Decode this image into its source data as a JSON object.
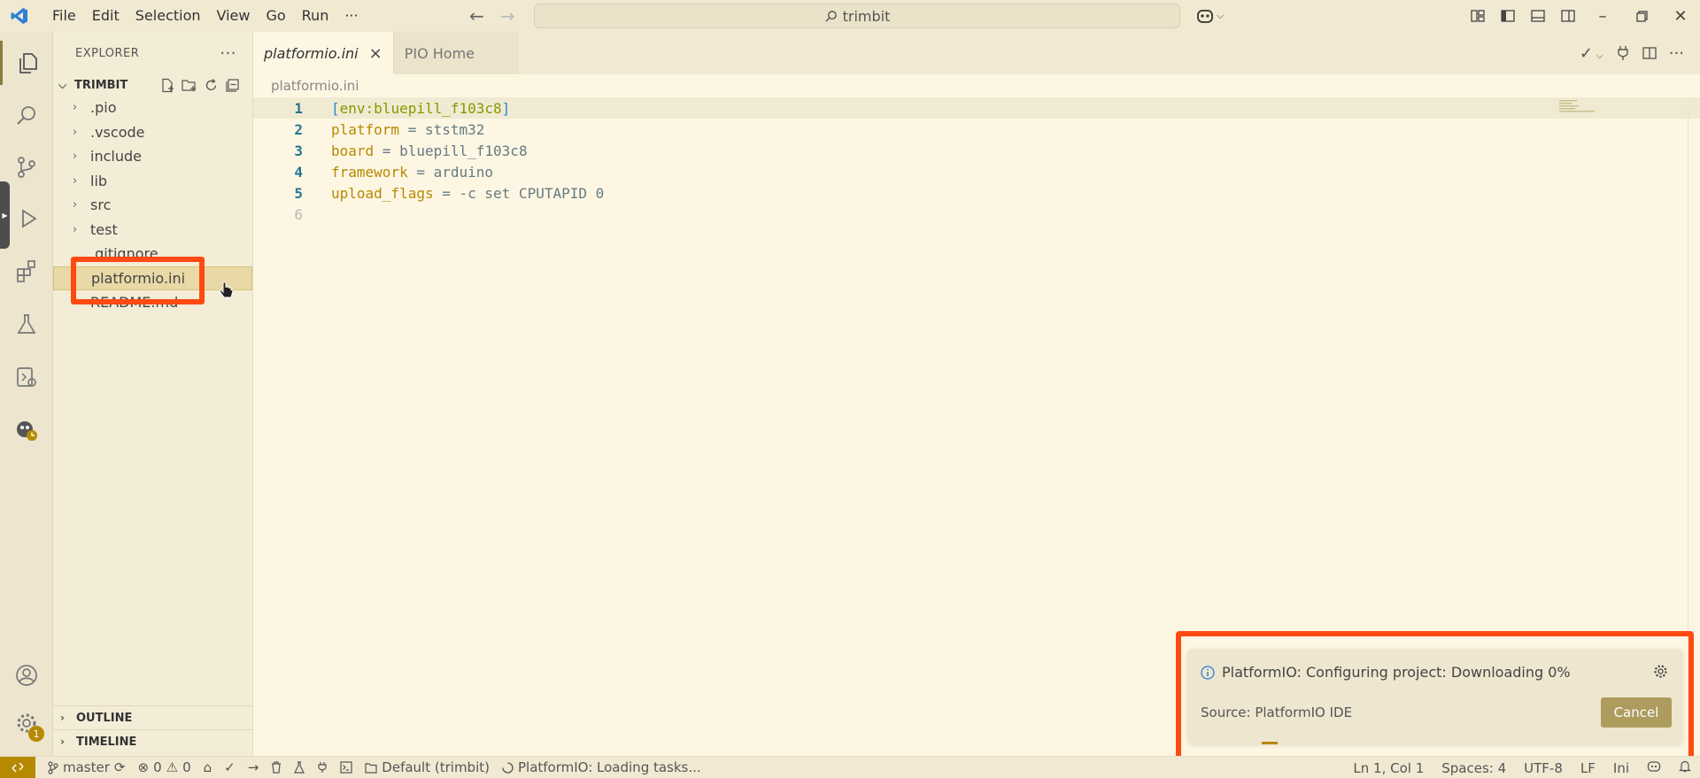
{
  "titlebar": {
    "menu": [
      "File",
      "Edit",
      "Selection",
      "View",
      "Go",
      "Run",
      "···"
    ],
    "search_text": "trimbit"
  },
  "explorer": {
    "header": "EXPLORER",
    "more": "···",
    "project": "TRIMBIT",
    "folders": [
      ".pio",
      ".vscode",
      "include",
      "lib",
      "src",
      "test"
    ],
    "files": [
      ".gitignore",
      "platformio.ini",
      "README.md"
    ],
    "outline": "OUTLINE",
    "timeline": "TIMELINE"
  },
  "activitybar": {
    "settings_badge": "1"
  },
  "editor": {
    "tabs": [
      {
        "label": "platformio.ini",
        "active": true
      },
      {
        "label": "PIO Home",
        "active": false
      }
    ],
    "breadcrumb": "platformio.ini",
    "line_numbers": [
      "1",
      "2",
      "3",
      "4",
      "5",
      "6"
    ],
    "lines": [
      {
        "a": "[",
        "b": "env:bluepill_f103c8",
        "c": "]"
      },
      {
        "key": "platform",
        "op": " = ",
        "val": "ststm32"
      },
      {
        "key": "board",
        "op": " = ",
        "val": "bluepill_f103c8"
      },
      {
        "key": "framework",
        "op": " = ",
        "val": "arduino"
      },
      {
        "key": "upload_flags",
        "op": " = ",
        "val": "-c set CPUTAPID 0"
      }
    ]
  },
  "notification": {
    "message": "PlatformIO: Configuring project: Downloading 0%",
    "source": "Source: PlatformIO IDE",
    "cancel": "Cancel"
  },
  "statusbar": {
    "branch": "master",
    "errors": "0",
    "warnings": "0",
    "env": "Default (trimbit)",
    "loading": "PlatformIO: Loading tasks...",
    "position": "Ln 1, Col 1",
    "spaces": "Spaces: 4",
    "encoding": "UTF-8",
    "eol": "LF",
    "language": "Ini"
  },
  "colors": {
    "accent": "#b58900",
    "highlight": "#ff4a12",
    "background": "#fdf6e3"
  }
}
